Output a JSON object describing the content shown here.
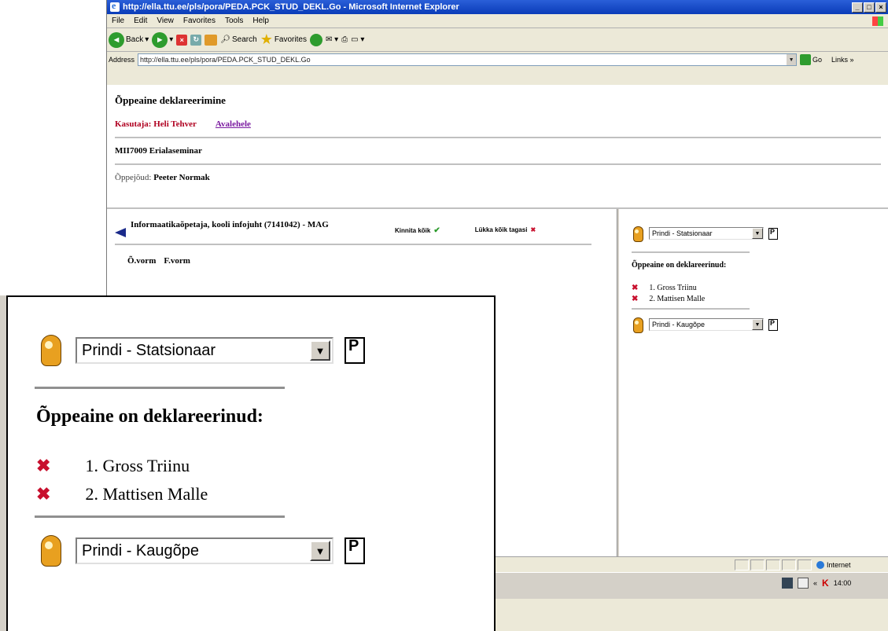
{
  "browser": {
    "title": "http://ella.ttu.ee/pls/pora/PEDA.PCK_STUD_DEKL.Go - Microsoft Internet Explorer",
    "menu": [
      "File",
      "Edit",
      "View",
      "Favorites",
      "Tools",
      "Help"
    ],
    "toolbar": {
      "back": "Back",
      "search": "Search",
      "favorites": "Favorites"
    },
    "address_label": "Address",
    "address_value": "http://ella.ttu.ee/pls/pora/PEDA.PCK_STUD_DEKL.Go",
    "go_label": "Go",
    "links_label": "Links »",
    "status_zone": "Internet",
    "clock": "14:00"
  },
  "page": {
    "title": "Õppeaine deklareerimine",
    "user_label": "Kasutaja: Heli Tehver",
    "home_link": "Avalehele",
    "course": "MII7009 Erialaseminar",
    "teacher_label": "Õppejõud:",
    "teacher_name": "Peeter Normak"
  },
  "left": {
    "program": "Informaatikaõpetaja, kooli infojuht (7141042) - MAG",
    "accept_all": "Kinnita kõik",
    "reject_all": "Lükka kõik tagasi",
    "col_ovorm": "Õ.vorm",
    "col_fvorm": "F.vorm"
  },
  "right": {
    "print_stationary": "Prindi - Statsionaar",
    "declared_title": "Õppeaine on deklareerinud:",
    "students": [
      "1. Gross Triinu",
      "2. Mattisen Malle"
    ],
    "print_distance": "Prindi - Kaugõpe"
  }
}
